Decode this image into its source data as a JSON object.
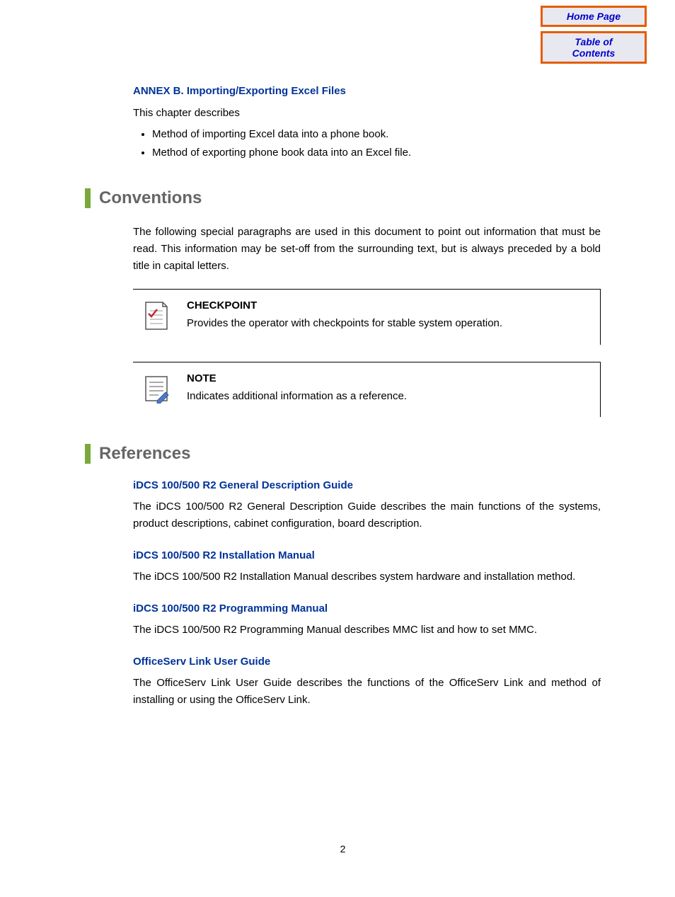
{
  "nav": {
    "home": "Home Page",
    "toc": "Table of Contents"
  },
  "annex": {
    "title": "ANNEX B. Importing/Exporting Excel Files",
    "intro": "This chapter describes",
    "bullets": [
      "Method of importing Excel data into a phone book.",
      "Method of exporting phone book data into an Excel file."
    ]
  },
  "sections": {
    "conventions": {
      "heading": "Conventions",
      "para": "The following special paragraphs are used in this document to point out information that must be read. This information may be set-off from the surrounding text, but is always preceded by a bold title in capital letters.",
      "callouts": [
        {
          "title": "CHECKPOINT",
          "text": "Provides the operator with checkpoints for stable system operation."
        },
        {
          "title": "NOTE",
          "text": "Indicates additional information as a reference."
        }
      ]
    },
    "references": {
      "heading": "References",
      "items": [
        {
          "title": "iDCS 100/500 R2 General Description Guide",
          "text": "The iDCS 100/500 R2 General Description Guide describes the main functions of the systems, product descriptions, cabinet configuration, board description."
        },
        {
          "title": "iDCS 100/500 R2 Installation Manual",
          "text": "The iDCS 100/500 R2 Installation Manual describes system hardware and installation method."
        },
        {
          "title": "iDCS 100/500 R2 Programming Manual",
          "text": "The iDCS 100/500 R2 Programming Manual describes MMC list and how to set MMC."
        },
        {
          "title": "OfficeServ Link User Guide",
          "text": "The OfficeServ Link User Guide describes the functions of the OfficeServ Link and method of installing or using the OfficeServ Link."
        }
      ]
    }
  },
  "page_number": "2"
}
